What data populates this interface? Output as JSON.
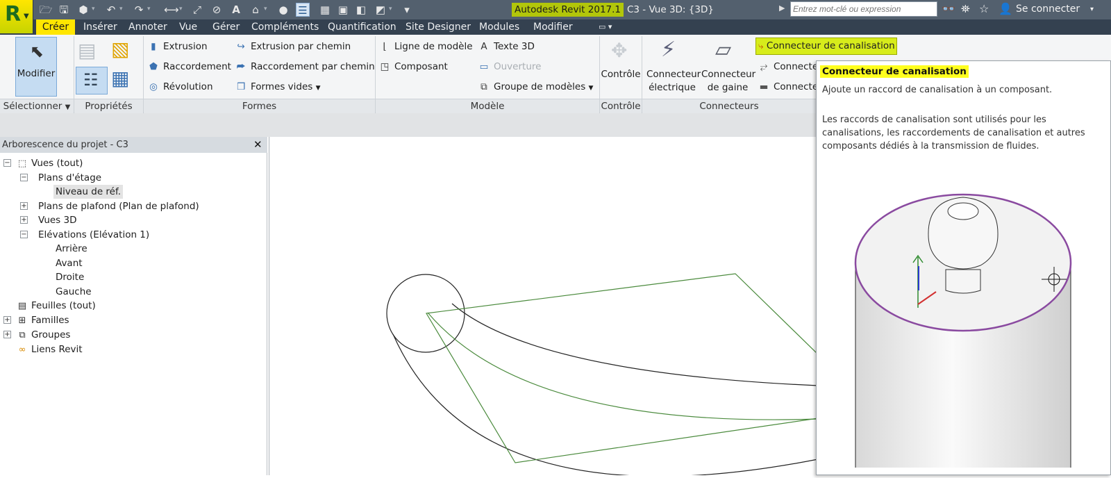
{
  "app": {
    "title": "Autodesk Revit 2017.1",
    "document": "C3 - Vue 3D: {3D}",
    "logo": "R",
    "search_placeholder": "Entrez mot-clé ou expression",
    "signin": "Se connecter",
    "accent_color": "#ffe600"
  },
  "menu": {
    "tabs": [
      "Créer",
      "Insérer",
      "Annoter",
      "Vue",
      "Gérer",
      "Compléments",
      "Quantification",
      "Site Designer",
      "Modules",
      "Modifier"
    ],
    "active": "Créer"
  },
  "ribbon": {
    "select": {
      "modifier": "Modifier",
      "panel": "Sélectionner"
    },
    "properties": {
      "panel": "Propriétés"
    },
    "forms": {
      "panel": "Formes",
      "extrusion": "Extrusion",
      "raccordement": "Raccordement",
      "revolution": "Révolution",
      "extrusion_chemin": "Extrusion par chemin",
      "raccordement_chemin": "Raccordement par chemin",
      "formes_vides": "Formes vides"
    },
    "model": {
      "panel": "Modèle",
      "ligne": "Ligne de modèle",
      "composant": "Composant",
      "texte3d": "Texte 3D",
      "ouverture": "Ouverture",
      "groupe": "Groupe de modèles"
    },
    "control": {
      "panel": "Contrôle",
      "button": "Contrôle"
    },
    "connectors": {
      "panel": "Connecteurs",
      "electrique_1": "Connecteur",
      "electrique_2": "électrique",
      "gaine_1": "Connecteur",
      "gaine_2": "de gaine",
      "canalisation": "Connecteur de canalisation",
      "connect2": "Connecte",
      "connect3": "Connecte"
    }
  },
  "browser": {
    "title": "Arborescence du projet - C3",
    "items": {
      "vues": "Vues (tout)",
      "plans_etage": "Plans d'étage",
      "niveau": "Niveau de réf.",
      "plafond": "Plans de plafond (Plan de plafond)",
      "vues3d": "Vues 3D",
      "elevations": "Elévations (Elévation 1)",
      "arriere": "Arrière",
      "avant": "Avant",
      "droite": "Droite",
      "gauche": "Gauche",
      "feuilles": "Feuilles (tout)",
      "familles": "Familles",
      "groupes": "Groupes",
      "liens": "Liens Revit"
    }
  },
  "tooltip": {
    "title": "Connecteur de canalisation",
    "short": "Ajoute un raccord de canalisation à un composant.",
    "long": "Les raccords de canalisation sont utilisés pour les canalisations, les raccordements de canalisation et autres composants dédiés à la transmission de fluides."
  }
}
